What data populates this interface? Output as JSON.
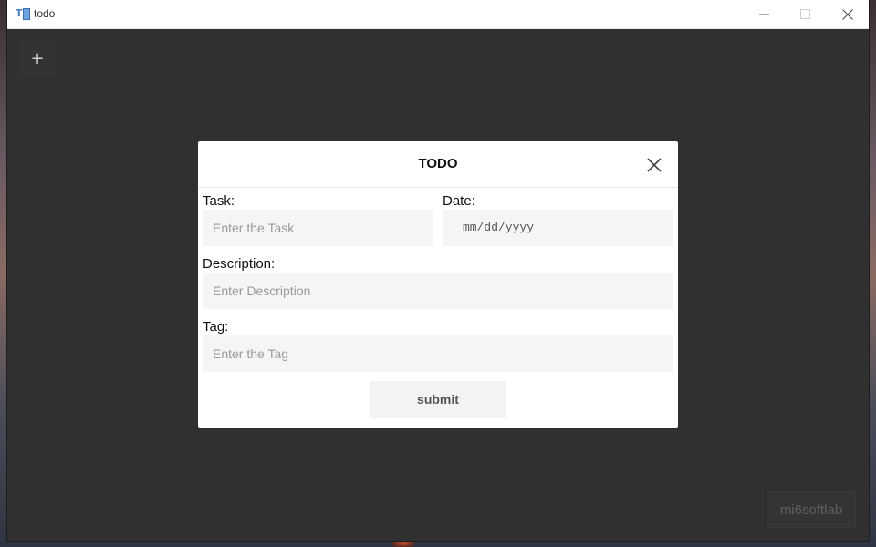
{
  "window": {
    "title": "todo",
    "icon": "app-todo-icon"
  },
  "toolbar": {
    "add_label": "+",
    "brand_label": "mi6softlab"
  },
  "modal": {
    "title": "TODO",
    "task": {
      "label": "Task:",
      "placeholder": "Enter the Task"
    },
    "date": {
      "label": "Date:",
      "placeholder": "mm/dd/yyyy"
    },
    "description": {
      "label": "Description:",
      "placeholder": "Enter Description"
    },
    "tag": {
      "label": "Tag:",
      "placeholder": "Enter the Tag"
    },
    "submit_label": "submit"
  },
  "colors": {
    "window_bg": "#303030",
    "modal_bg": "#ffffff",
    "input_bg": "#f5f5f5"
  }
}
